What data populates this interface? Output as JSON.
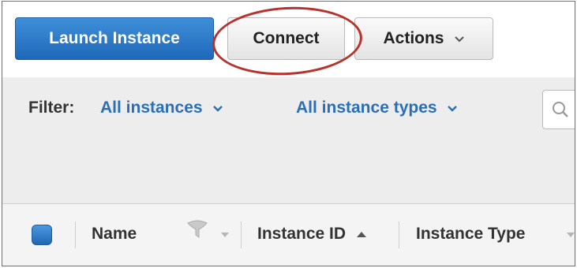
{
  "toolbar": {
    "launch_label": "Launch Instance",
    "connect_label": "Connect",
    "actions_label": "Actions",
    "actions_icon": "chevron-down-icon",
    "launch_color": "#1f68b9",
    "annotation_color": "#b8312b"
  },
  "filter": {
    "label": "Filter:",
    "instances_selected": "All instances",
    "types_selected": "All instance types",
    "link_color": "#2a6fb5",
    "search_icon": "search-icon"
  },
  "table": {
    "select_all_checked": true,
    "columns": [
      {
        "label": "Name",
        "icon": "filter-funnel-icon"
      },
      {
        "label": "Instance ID",
        "sort": "ascending"
      },
      {
        "label": "Instance Type"
      }
    ]
  }
}
